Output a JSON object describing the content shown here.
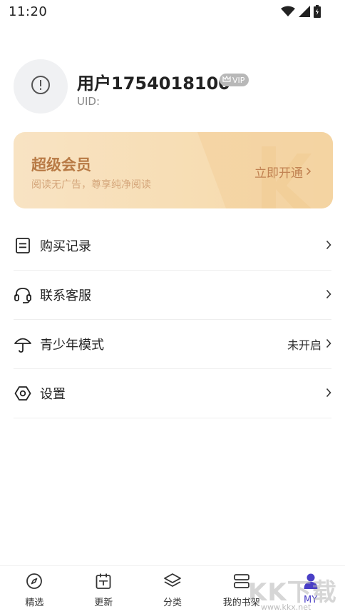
{
  "status_bar": {
    "time": "11:20"
  },
  "profile": {
    "username": "用户1754018100",
    "vip_badge": "VIP",
    "uid_label": "UID:"
  },
  "vip_card": {
    "title": "超级会员",
    "subtitle": "阅读无广告，尊享纯净阅读",
    "cta": "立即开通"
  },
  "menu": {
    "items": [
      {
        "label": "购买记录",
        "value": "",
        "icon": "receipt-icon"
      },
      {
        "label": "联系客服",
        "value": "",
        "icon": "headset-icon"
      },
      {
        "label": "青少年模式",
        "value": "未开启",
        "icon": "umbrella-icon"
      },
      {
        "label": "设置",
        "value": "",
        "icon": "hexagon-settings-icon"
      }
    ]
  },
  "tabbar": {
    "tabs": [
      {
        "label": "精选",
        "icon": "compass-icon"
      },
      {
        "label": "更新",
        "icon": "calendar-icon"
      },
      {
        "label": "分类",
        "icon": "layers-icon"
      },
      {
        "label": "我的书架",
        "icon": "bookshelf-icon"
      },
      {
        "label": "MY",
        "icon": "person-icon",
        "active": true
      }
    ]
  },
  "watermark": {
    "big": "KK下载",
    "small": "www.kkx.net"
  },
  "colors": {
    "accent": "#4a3fc6",
    "vip_gold": "#b87a45",
    "vip_bg": "#f8e3c3"
  }
}
